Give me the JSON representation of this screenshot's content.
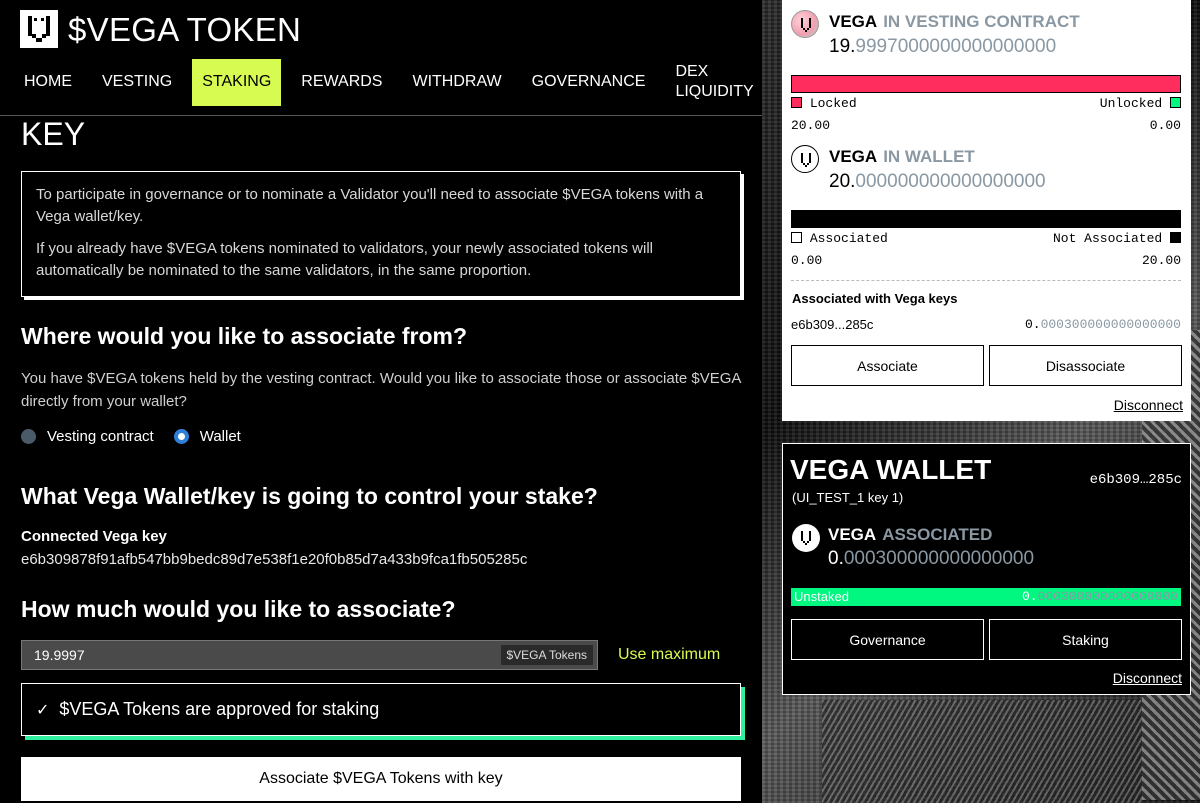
{
  "brand": {
    "name": "$VEGA TOKEN"
  },
  "nav": [
    {
      "label": "HOME"
    },
    {
      "label": "VESTING"
    },
    {
      "label": "STAKING"
    },
    {
      "label": "REWARDS"
    },
    {
      "label": "WITHDRAW"
    },
    {
      "label": "GOVERNANCE"
    },
    {
      "label": "DEX LIQUIDITY"
    }
  ],
  "page": {
    "title": "KEY",
    "info": [
      "To participate in governance or to nominate a Validator you'll need to associate $VEGA tokens with a Vega wallet/key.",
      "If you already have $VEGA tokens nominated to validators, your newly associated tokens will automatically be nominated to the same validators, in the same proportion."
    ],
    "from_heading": "Where would you like to associate from?",
    "from_desc": "You have $VEGA tokens held by the vesting contract. Would you like to associate those or associate $VEGA directly from your wallet?",
    "radios": [
      {
        "label": "Vesting contract",
        "checked": false
      },
      {
        "label": "Wallet",
        "checked": true
      }
    ],
    "control_heading": "What Vega Wallet/key is going to control your stake?",
    "connected_label": "Connected Vega key",
    "connected_key": "e6b309878f91afb547bb9bedc89d7e538f1e20f0b85d7a433b9fca1fb505285c",
    "amount_heading": "How much would you like to associate?",
    "amount_value": "19.9997",
    "amount_token_label": "$VEGA Tokens",
    "use_max": "Use maximum",
    "approved_icon": "check-icon",
    "approved_text": "$VEGA Tokens are approved for staking",
    "submit_label": "Associate $VEGA Tokens with key"
  },
  "eth_wallet": {
    "vesting": {
      "token": "VEGA",
      "qualifier": "IN VESTING CONTRACT",
      "amount_lead": "19.",
      "amount_trail": "9997000000000000000",
      "locked_label": "Locked",
      "unlocked_label": "Unlocked",
      "locked_value": "20.00",
      "unlocked_value": "0.00",
      "locked_fraction": 1.0,
      "locked_color": "#ff2d5e",
      "unlocked_color": "#00f780"
    },
    "wallet": {
      "token": "VEGA",
      "qualifier": "IN WALLET",
      "amount_lead": "20.",
      "amount_trail": "000000000000000000",
      "associated_label": "Associated",
      "not_associated_label": "Not Associated",
      "associated_value": "0.00",
      "not_associated_value": "20.00",
      "associated_fraction": 0.0
    },
    "assoc_keys_heading": "Associated with Vega keys",
    "assoc_key_short": "e6b309...285c",
    "assoc_key_amount_lead": "0.",
    "assoc_key_amount_trail": "000300000000000000",
    "associate_btn": "Associate",
    "disassociate_btn": "Disassociate",
    "disconnect": "Disconnect"
  },
  "vega_wallet": {
    "title": "VEGA WALLET",
    "key_short": "e6b309…285c",
    "key_name": "(UI_TEST_1 key 1)",
    "token": "VEGA",
    "qualifier": "ASSOCIATED",
    "amount_lead": "0.",
    "amount_trail": "000300000000000000",
    "unstaked_label": "Unstaked",
    "unstaked_value_lead": "0.",
    "unstaked_value_trail": "000300000000000000",
    "unstaked_fraction": 1.0,
    "unstaked_color": "#00f780",
    "governance_btn": "Governance",
    "staking_btn": "Staking",
    "disconnect": "Disconnect"
  }
}
